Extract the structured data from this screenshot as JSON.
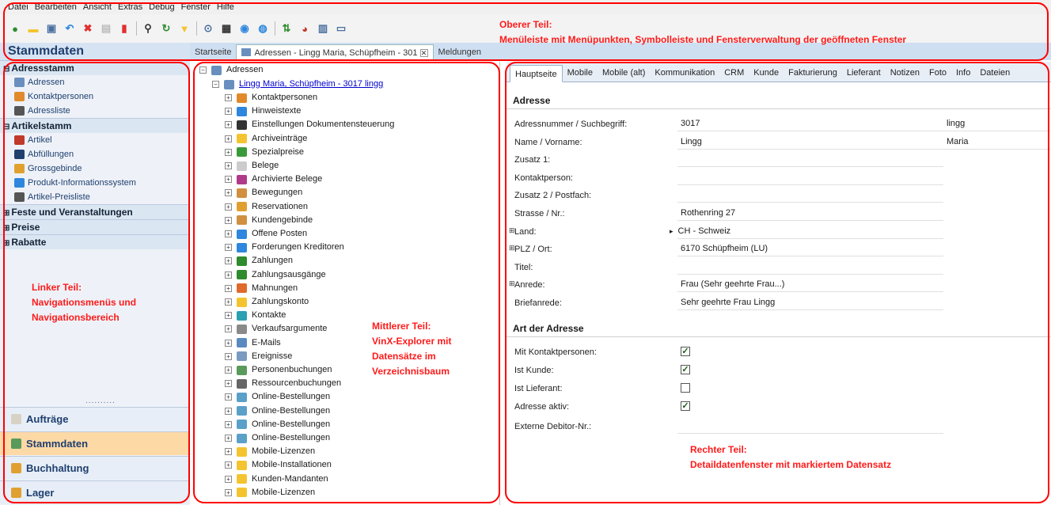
{
  "menubar": {
    "items": [
      "Datei",
      "Bearbeiten",
      "Ansicht",
      "Extras",
      "Debug",
      "Fenster",
      "Hilfe"
    ]
  },
  "toolbar": {
    "icons": [
      "new-icon",
      "open-icon",
      "save-icon",
      "undo-icon",
      "cancel-icon",
      "copy-icon",
      "bookmark-icon",
      "search-icon",
      "refresh-icon",
      "filter-icon",
      "zoom-icon",
      "print-icon",
      "preview-icon",
      "pdf-icon",
      "sort-icon",
      "chart-icon",
      "document-icon",
      "message-icon"
    ]
  },
  "doc_tabs": {
    "start": "Startseite",
    "adressen": "Adressen - Lingg Maria, Schüpfheim - 301",
    "meldungen": "Meldungen"
  },
  "nav": {
    "title": "Stammdaten",
    "groups": [
      {
        "label": "Adressstamm",
        "expander": "⊟",
        "items": [
          {
            "label": "Adressen",
            "icon": "address-icon",
            "color": "#6a8fbf"
          },
          {
            "label": "Kontaktpersonen",
            "icon": "person-icon",
            "color": "#e08a2c"
          },
          {
            "label": "Adressliste",
            "icon": "printer-icon",
            "color": "#555555"
          }
        ]
      },
      {
        "label": "Artikelstamm",
        "expander": "⊟",
        "items": [
          {
            "label": "Artikel",
            "icon": "article-icon",
            "color": "#c0392b"
          },
          {
            "label": "Abfüllungen",
            "icon": "bottle-icon",
            "color": "#1f3f6f"
          },
          {
            "label": "Grossgebinde",
            "icon": "crate-icon",
            "color": "#e0a030"
          },
          {
            "label": "Produkt-Informationssystem",
            "icon": "info-icon",
            "color": "#2e86de"
          },
          {
            "label": "Artikel-Preisliste",
            "icon": "printer-icon",
            "color": "#555555"
          }
        ]
      },
      {
        "label": "Feste und Veranstaltungen",
        "expander": "⊞",
        "items": []
      },
      {
        "label": "Preise",
        "expander": "⊞",
        "items": []
      },
      {
        "label": "Rabatte",
        "expander": "⊞",
        "items": []
      }
    ],
    "grip": "..........",
    "buttons": [
      {
        "label": "Aufträge",
        "icon": "orders-icon",
        "color": "#d8d2c4",
        "active": false
      },
      {
        "label": "Stammdaten",
        "icon": "masterdata-icon",
        "color": "#5a9a5a",
        "active": true
      },
      {
        "label": "Buchhaltung",
        "icon": "accounting-icon",
        "color": "#e0a030",
        "active": false
      },
      {
        "label": "Lager",
        "icon": "warehouse-icon",
        "color": "#e0a030",
        "active": false
      }
    ]
  },
  "explorer": {
    "root": "Adressen",
    "record": "Lingg Maria, Schüpfheim - 3017 lingg",
    "children": [
      {
        "label": "Kontaktpersonen",
        "icon": "person-icon",
        "color": "#e08a2c"
      },
      {
        "label": "Hinweistexte",
        "icon": "info-icon",
        "color": "#2e86de"
      },
      {
        "label": "Einstellungen Dokumentensteuerung",
        "icon": "gear-icon",
        "color": "#333333"
      },
      {
        "label": "Archiveinträge",
        "icon": "folder-icon",
        "color": "#f4c430"
      },
      {
        "label": "Spezialpreise",
        "icon": "price-icon",
        "color": "#3a9a3a"
      },
      {
        "label": "Belege",
        "icon": "document-icon",
        "color": "#cccccc"
      },
      {
        "label": "Archivierte Belege",
        "icon": "archive-icon",
        "color": "#b03a8a"
      },
      {
        "label": "Bewegungen",
        "icon": "movement-icon",
        "color": "#d09040"
      },
      {
        "label": "Reservationen",
        "icon": "reservation-icon",
        "color": "#e0a030"
      },
      {
        "label": "Kundengebinde",
        "icon": "crate-icon",
        "color": "#d09040"
      },
      {
        "label": "Offene Posten",
        "icon": "dollar-icon",
        "color": "#2e86de"
      },
      {
        "label": "Forderungen Kreditoren",
        "icon": "dollar-icon",
        "color": "#2e86de"
      },
      {
        "label": "Zahlungen",
        "icon": "payment-icon",
        "color": "#2e8b2e"
      },
      {
        "label": "Zahlungsausgänge",
        "icon": "payment-icon",
        "color": "#2e8b2e"
      },
      {
        "label": "Mahnungen",
        "icon": "reminder-icon",
        "color": "#e06a2c"
      },
      {
        "label": "Zahlungskonto",
        "icon": "folder-icon",
        "color": "#f4c430"
      },
      {
        "label": "Kontakte",
        "icon": "contact-icon",
        "color": "#2aa0b0"
      },
      {
        "label": "Verkaufsargumente",
        "icon": "table-icon",
        "color": "#8a8a8a"
      },
      {
        "label": "E-Mails",
        "icon": "email-icon",
        "color": "#5a8ac0"
      },
      {
        "label": "Ereignisse",
        "icon": "event-icon",
        "color": "#7a9ac0"
      },
      {
        "label": "Personenbuchungen",
        "icon": "booking-icon",
        "color": "#5a9a5a"
      },
      {
        "label": "Ressourcenbuchungen",
        "icon": "resource-icon",
        "color": "#666666"
      },
      {
        "label": "Online-Bestellungen",
        "icon": "order-icon",
        "color": "#5aa0c8"
      },
      {
        "label": "Online-Bestellungen",
        "icon": "order-icon",
        "color": "#5aa0c8"
      },
      {
        "label": "Online-Bestellungen",
        "icon": "order-icon",
        "color": "#5aa0c8"
      },
      {
        "label": "Online-Bestellungen",
        "icon": "order-icon",
        "color": "#5aa0c8"
      },
      {
        "label": "Mobile-Lizenzen",
        "icon": "folder-icon",
        "color": "#f4c430"
      },
      {
        "label": "Mobile-Installationen",
        "icon": "folder-icon",
        "color": "#f4c430"
      },
      {
        "label": "Kunden-Mandanten",
        "icon": "folder-icon",
        "color": "#f4c430"
      },
      {
        "label": "Mobile-Lizenzen",
        "icon": "folder-icon",
        "color": "#f4c430"
      }
    ]
  },
  "detail": {
    "tabs": [
      "Hauptseite",
      "Mobile",
      "Mobile (alt)",
      "Kommunikation",
      "CRM",
      "Kunde",
      "Fakturierung",
      "Lieferant",
      "Notizen",
      "Foto",
      "Info",
      "Dateien"
    ],
    "sect_address": "Adresse",
    "fields": [
      {
        "label": "Adressnummer / Suchbegriff:",
        "value": "3017",
        "value2": "lingg",
        "expand": false
      },
      {
        "label": "Name / Vorname:",
        "value": "Lingg",
        "value2": "Maria",
        "expand": false
      },
      {
        "label": "Zusatz 1:",
        "value": "",
        "expand": false
      },
      {
        "label": "Kontaktperson:",
        "value": "",
        "expand": false
      },
      {
        "label": "Zusatz 2 / Postfach:",
        "value": "",
        "expand": false
      },
      {
        "label": "Strasse / Nr.:",
        "value": "Rothenring 27",
        "expand": false
      },
      {
        "label": "Land:",
        "value": "CH - Schweiz",
        "expand": true,
        "marker": "▸"
      },
      {
        "label": "PLZ / Ort:",
        "value": "6170 Schüpfheim (LU)",
        "expand": true
      },
      {
        "label": "Titel:",
        "value": "",
        "expand": false
      },
      {
        "label": "Anrede:",
        "value": "Frau (Sehr geehrte Frau...)",
        "expand": true
      },
      {
        "label": "Briefanrede:",
        "value": "Sehr geehrte Frau Lingg",
        "expand": false
      }
    ],
    "sect_type": "Art der Adresse",
    "checks": [
      {
        "label": "Mit Kontaktpersonen:",
        "checked": true
      },
      {
        "label": "Ist Kunde:",
        "checked": true
      },
      {
        "label": "Ist Lieferant:",
        "checked": false
      },
      {
        "label": "Adresse aktiv:",
        "checked": true
      }
    ],
    "extern_label": "Externe Debitor-Nr.:",
    "extern_value": ""
  },
  "annotations": {
    "top_1": "Oberer Teil:",
    "top_2": "Menüleiste mit Menüpunkten, Symbolleiste und Fensterverwaltung der geöffneten Fenster",
    "left_1": "Linker Teil:",
    "left_2": "Navigationsmenüs und",
    "left_3": "Navigationsbereich",
    "mid_1": "Mittlerer Teil:",
    "mid_2": "VinX-Explorer mit",
    "mid_3": "Datensätze im",
    "mid_4": "Verzeichnisbaum",
    "right_1": "Rechter Teil:",
    "right_2": "Detaildatenfenster mit markiertem Datensatz"
  },
  "colors": {
    "annotation": "#ff0000",
    "nav_active": "#fdd9a6",
    "link": "#0000cc"
  }
}
